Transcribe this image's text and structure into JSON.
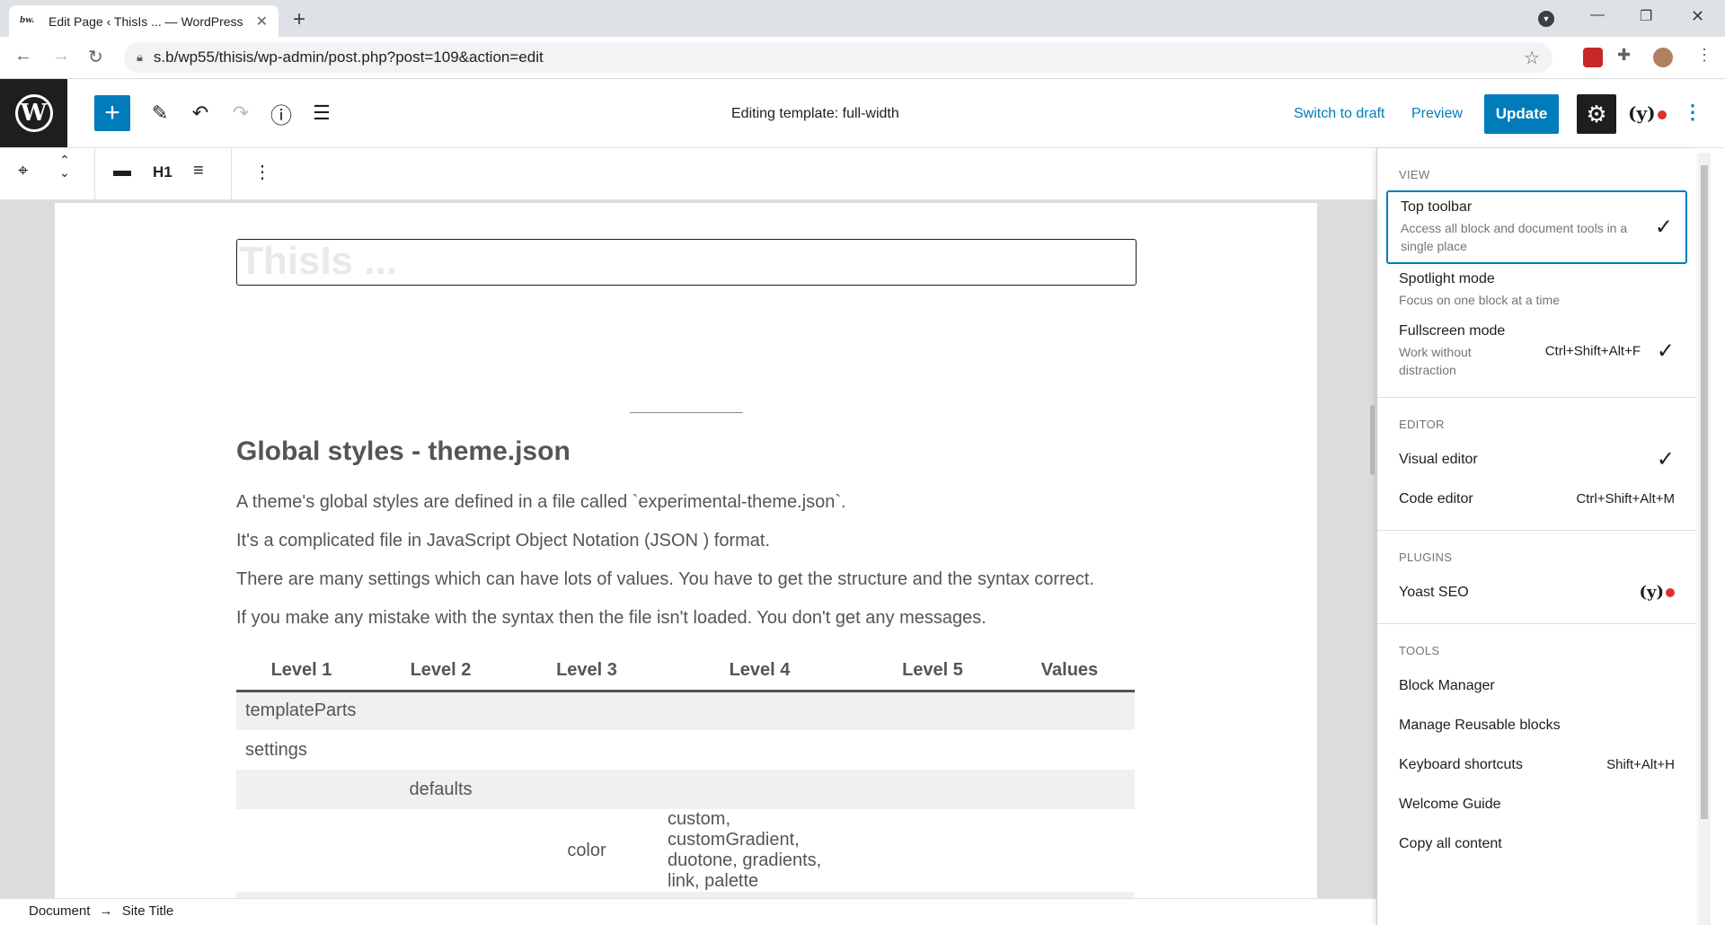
{
  "browser": {
    "tab_title": "Edit Page ‹ ThisIs ... — WordPress",
    "favicon_text": "bw.",
    "url": "s.b/wp55/thisis/wp-admin/post.php?post=109&action=edit"
  },
  "header": {
    "editing_title": "Editing template: full-width",
    "switch_to_draft": "Switch to draft",
    "preview": "Preview",
    "update": "Update"
  },
  "block_toolbar": {
    "heading_level": "H1"
  },
  "content": {
    "title_placeholder": "ThisIs ...",
    "heading": "Global styles - theme.json",
    "paragraphs": [
      "A theme's global styles are defined in a file called `experimental-theme.json`.",
      "It's a complicated file in JavaScript Object Notation (JSON ) format.",
      "There are many settings which can have lots of values. You have to get the structure and the syntax correct.",
      "If you make any mistake with the syntax then the file isn't loaded. You don't get any messages."
    ],
    "table": {
      "headers": [
        "Level 1",
        "Level 2",
        "Level 3",
        "Level 4",
        "Level 5",
        "Values"
      ],
      "rows": [
        [
          "templateParts",
          "",
          "",
          "",
          "",
          ""
        ],
        [
          "settings",
          "",
          "",
          "",
          "",
          ""
        ],
        [
          "",
          "defaults",
          "",
          "",
          "",
          ""
        ],
        [
          "",
          "",
          "color",
          "custom, customGradient, duotone, gradients, link, palette",
          "",
          ""
        ]
      ]
    }
  },
  "statusbar": {
    "document": "Document",
    "arrow": "→",
    "site_title": "Site Title"
  },
  "menu": {
    "view_heading": "View",
    "view_items": [
      {
        "label": "Top toolbar",
        "desc": "Access all block and document tools in a single place"
      },
      {
        "label": "Spotlight mode",
        "desc": "Focus on one block at a time"
      },
      {
        "label": "Fullscreen mode",
        "desc": "Work without distraction",
        "shortcut": "Ctrl+Shift+Alt+F"
      }
    ],
    "editor_heading": "Editor",
    "editor_items": [
      {
        "label": "Visual editor"
      },
      {
        "label": "Code editor",
        "shortcut": "Ctrl+Shift+Alt+M"
      }
    ],
    "plugins_heading": "Plugins",
    "plugins_items": [
      {
        "label": "Yoast SEO"
      }
    ],
    "tools_heading": "Tools",
    "tools_items": [
      {
        "label": "Block Manager"
      },
      {
        "label": "Manage Reusable blocks"
      },
      {
        "label": "Keyboard shortcuts",
        "shortcut": "Shift+Alt+H"
      },
      {
        "label": "Welcome Guide"
      },
      {
        "label": "Copy all content"
      }
    ]
  }
}
